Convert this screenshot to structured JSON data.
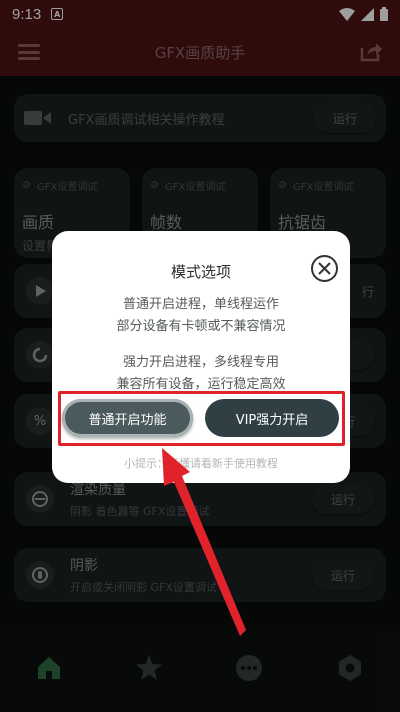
{
  "status_bar": {
    "time": "9:13",
    "notif_letter": "A"
  },
  "header": {
    "title": "GFX画质助手"
  },
  "tutorial": {
    "label": "GFX画质调试相关操作教程",
    "run": "运行"
  },
  "setting_cards": [
    {
      "head": "GFX设置调试",
      "title": "画质",
      "sub": "设置界"
    },
    {
      "head": "GFX设置调试",
      "title": "帧数",
      "sub": ""
    },
    {
      "head": "GFX设置调试",
      "title": "抗锯齿",
      "sub": ""
    }
  ],
  "list_rows": [
    {
      "title": "渲染质量",
      "sub": "阴影 着色器等 GFX设置调试",
      "run": "运行"
    },
    {
      "title": "阴影",
      "sub": "开启或关闭阴影 GFX设置调试",
      "run": "运行"
    }
  ],
  "partial_right": {
    "t1": "行",
    "r2": "运行"
  },
  "dialog": {
    "title": "模式选项",
    "line1": "普通开启进程，单线程运作",
    "line2": "部分设备有卡顿或不兼容情况",
    "line3": "强力开启进程，多线程专用",
    "line4": "兼容所有设备，运行稳定高效",
    "btn_normal": "普通开启功能",
    "btn_vip": "VIP强力开启",
    "tip": "小提示：不懂请看新手使用教程"
  },
  "colors": {
    "highlight": "#e0222a",
    "header_bg": "#4d1214",
    "nav_active": "#2f6b43"
  },
  "icons": {
    "nav": [
      "home-icon",
      "star-icon",
      "more-icon",
      "settings-icon"
    ]
  }
}
